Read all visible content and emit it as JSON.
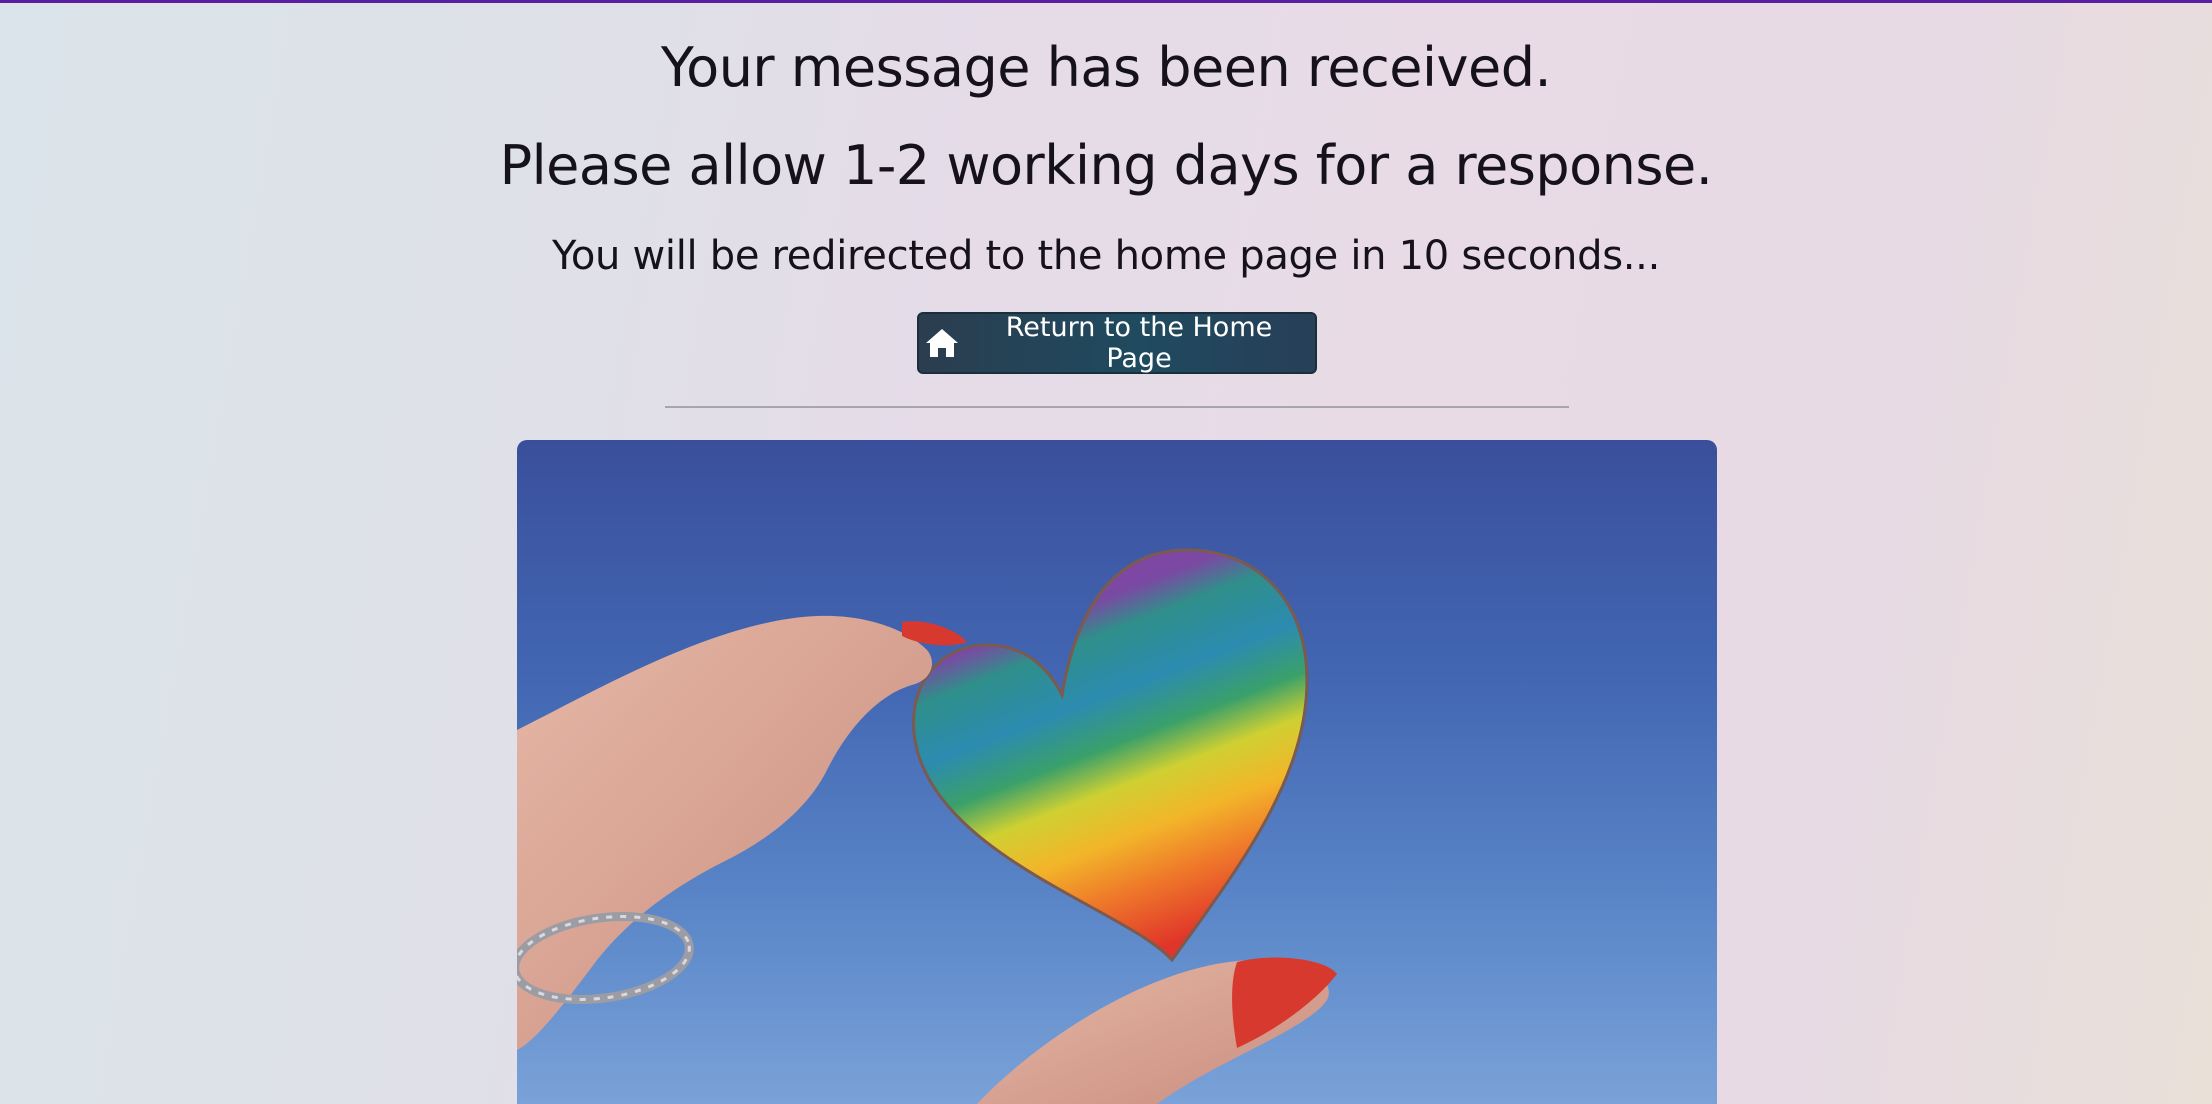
{
  "page": {
    "headline_1": "Your message has been received.",
    "headline_2": "Please allow 1-2 working days for a response.",
    "redirect_notice": "You will be redirected to the home page in 10 seconds..."
  },
  "home_button": {
    "label": "Return to the Home Page",
    "icon": "home-icon"
  },
  "image": {
    "subject": "rainbow heart held between fingers against blue sky"
  },
  "colors": {
    "accent_top_border": "#5a1fa0",
    "button_bg": "#1f4a5f",
    "button_text": "#ffffff",
    "text": "#16121c"
  }
}
